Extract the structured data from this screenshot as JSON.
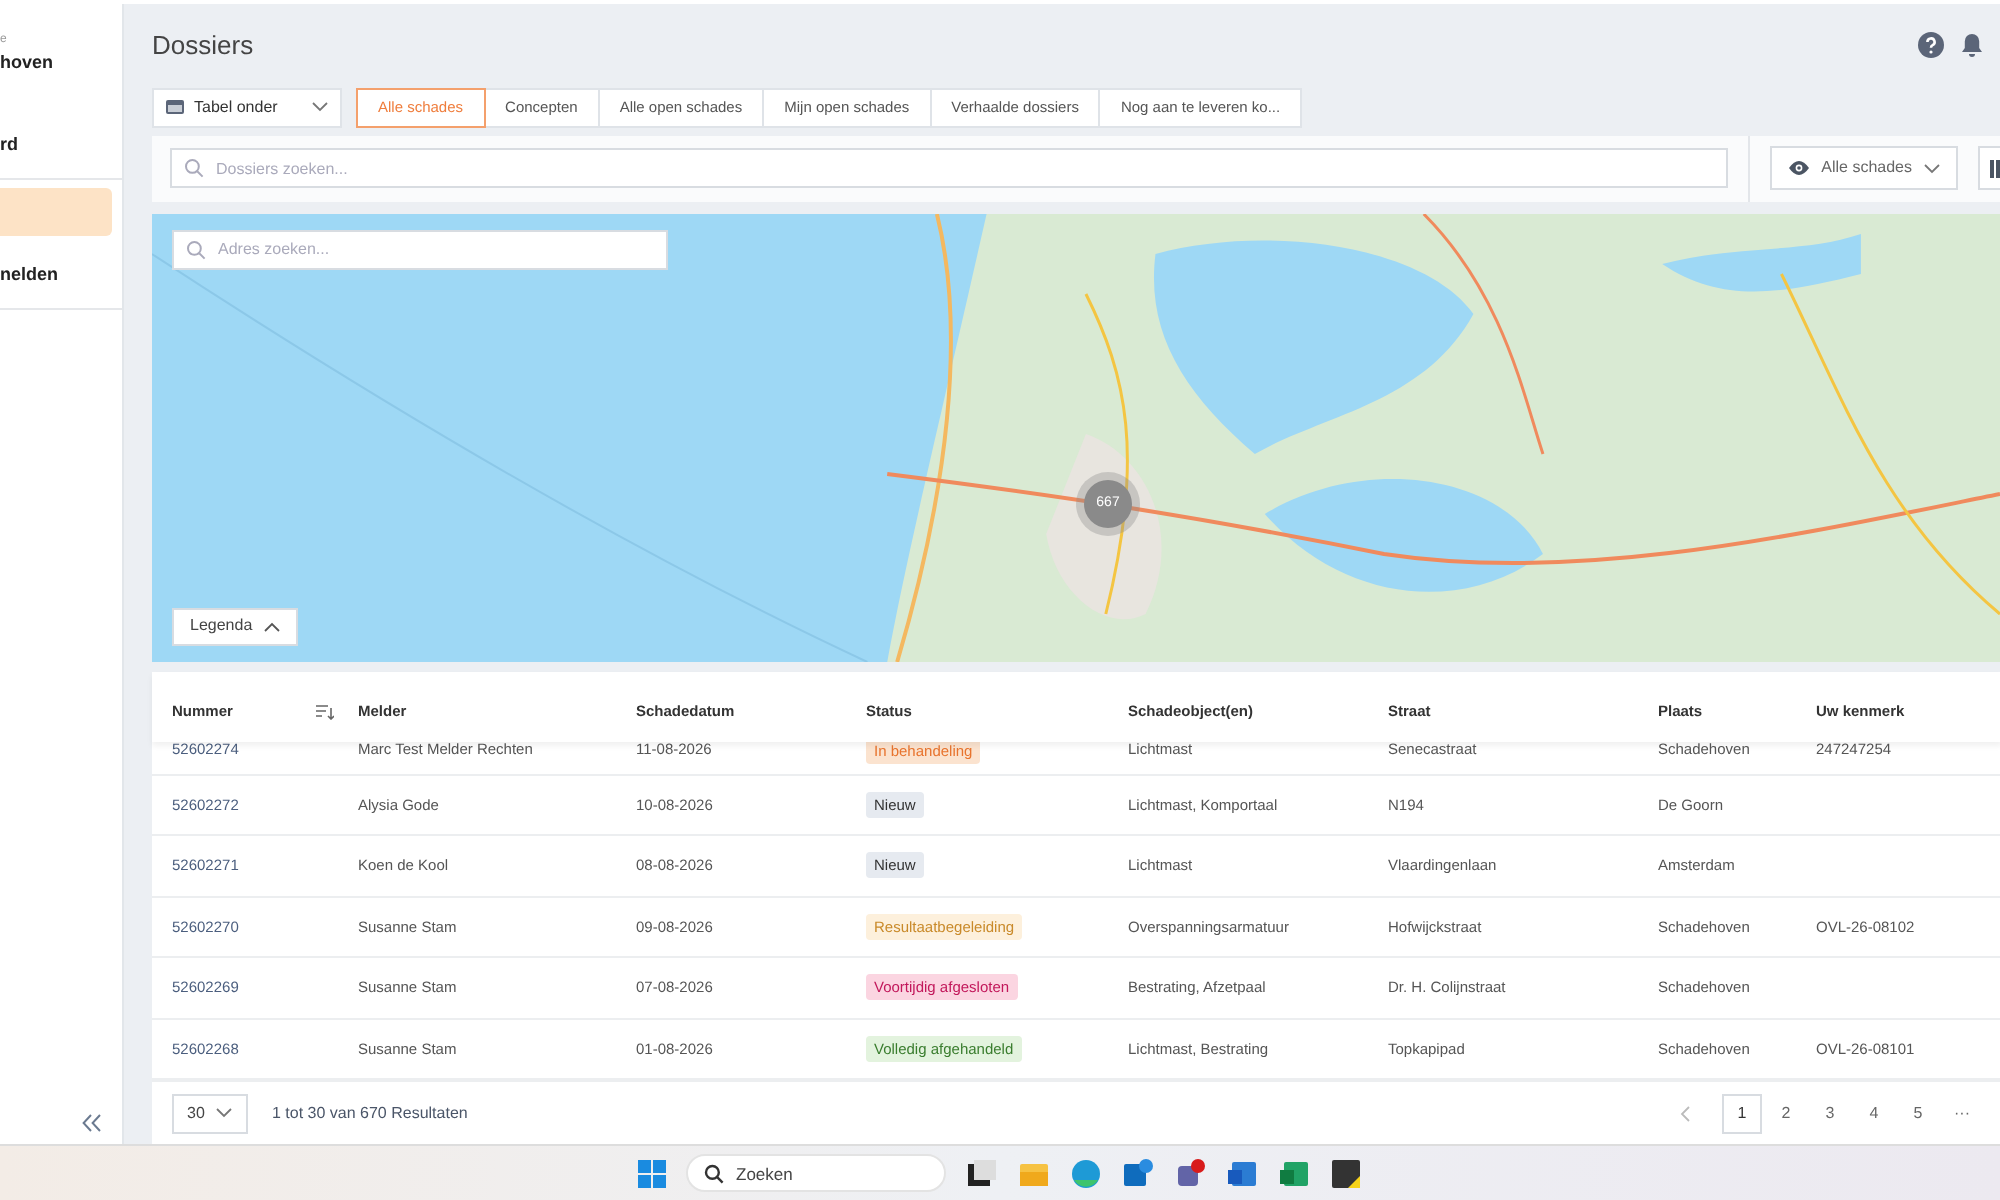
{
  "sidebar": {
    "org_caption": "e",
    "org_name": "hoven",
    "items": [
      {
        "label": "rd",
        "selected": false
      },
      {
        "selected": true
      },
      {
        "label": "nelden",
        "selected": false
      }
    ]
  },
  "header": {
    "title": "Dossiers"
  },
  "view_select": {
    "value": "Tabel onder"
  },
  "tabs": [
    {
      "label": "Alle schades",
      "selected": true
    },
    {
      "label": "Concepten",
      "selected": false
    },
    {
      "label": "Alle open schades",
      "selected": false
    },
    {
      "label": "Mijn open schades",
      "selected": false
    },
    {
      "label": "Verhaalde dossiers",
      "selected": false
    },
    {
      "label": "Nog aan te leveren ko...",
      "selected": false
    }
  ],
  "search": {
    "placeholder": "Dossiers zoeken..."
  },
  "filter": {
    "value": "Alle schades"
  },
  "map": {
    "kind": "picture",
    "address_placeholder": "Adres zoeken...",
    "cluster": "667",
    "legend": "Legenda"
  },
  "table": {
    "columns": [
      "Nummer",
      "Melder",
      "Schadedatum",
      "Status",
      "Schadeobject(en)",
      "Straat",
      "Plaats",
      "Uw kenmerk"
    ],
    "rows": [
      {
        "nummer": "52602274",
        "melder": "Marc Test Melder Rechten",
        "datum": "11-08-2026",
        "status": "In behandeling",
        "color": "#fbe3cf",
        "object": "Lichtmast",
        "straat": "Senecastraat",
        "plaats": "Schadehoven",
        "kenmerk": "247247254"
      },
      {
        "nummer": "52602272",
        "melder": "Alysia Gode",
        "datum": "10-08-2026",
        "status": "Nieuw",
        "color": "#e6eaf0",
        "object": "Lichtmast, Komportaal",
        "straat": "N194",
        "plaats": "De Goorn"
      },
      {
        "nummer": "52602271",
        "melder": "Koen de Kool",
        "datum": "08-08-2026",
        "status": "Nieuw",
        "color": "#e6eaf0",
        "object": "Lichtmast",
        "straat": "Vlaardingenlaan",
        "plaats": "Amsterdam"
      },
      {
        "nummer": "52602270",
        "melder": "Susanne Stam",
        "datum": "09-08-2026",
        "status": "Resultaatbegeleiding",
        "color": "#fdf0dc",
        "object": "Overspanningsarmatuur",
        "straat": "Hofwijckstraat",
        "plaats": "Schadehoven",
        "kenmerk": "OVL-26-08102"
      },
      {
        "nummer": "52602269",
        "melder": "Susanne Stam",
        "datum": "07-08-2026",
        "status": "Voortijdig afgesloten",
        "color": "#fbd5e1",
        "object": "Bestrating, Afzetpaal",
        "straat": "Dr. H. Colijnstraat",
        "plaats": "Schadehoven"
      },
      {
        "nummer": "52602268",
        "melder": "Susanne Stam",
        "datum": "01-08-2026",
        "status": "Volledig afgehandeld",
        "color": "#e3f3de",
        "object": "Lichtmast, Bestrating",
        "straat": "Topkapipad",
        "plaats": "Schadehoven",
        "kenmerk": "OVL-26-08101"
      }
    ]
  },
  "footer": {
    "page_size": "30",
    "results": "1 tot 30 van 670 Resultaten",
    "pages": [
      {
        "label": "1",
        "selected": true
      },
      {
        "label": "2",
        "selected": false
      },
      {
        "label": "3",
        "selected": false
      },
      {
        "label": "4",
        "selected": false
      },
      {
        "label": "5",
        "selected": false
      }
    ],
    "more": "···"
  },
  "taskbar": {
    "search_placeholder": "Zoeken"
  }
}
